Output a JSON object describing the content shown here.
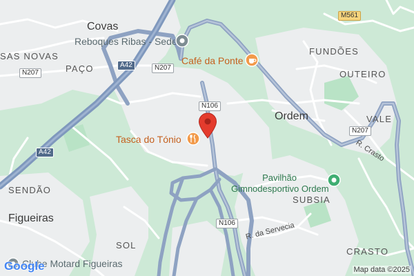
{
  "colors": {
    "land": "#cde9d6",
    "urban": "#eceeef",
    "park": "#b9e3c6",
    "road_minor": "#ffffff",
    "road_major": "#8ea2c2",
    "highway": "#7f98bd",
    "poi_orange": "#f29a4a",
    "poi_gray": "#7e8d93",
    "poi_green": "#3fae72",
    "marker": "#e43b2d"
  },
  "places": {
    "covas": "Covas",
    "casas_novas": "SAS NOVAS",
    "paco": "PAÇO",
    "fundoes": "FUNDÕES",
    "outeiro": "OUTEIRO",
    "ordem": "Ordem",
    "vale": "VALE",
    "sendao": "SENDÃO",
    "figueiras": "Figueiras",
    "subsia": "SUBSIA",
    "sol": "SOL",
    "crasto": "CRASTO"
  },
  "pois": {
    "reboques": {
      "name": "Reboques Ribas - Sede",
      "icon": "gray-pin-icon"
    },
    "cafe": {
      "name": "Café da Ponte",
      "icon": "coffee-icon"
    },
    "tasca": {
      "name": "Tasca do Tónio",
      "icon": "restaurant-icon"
    },
    "pavilhao": {
      "line1": "Pavilhão",
      "line2": "Gimnodesportivo Ordem",
      "icon": "sports-pin-icon"
    },
    "clube": {
      "name": "Clube Motard Figueiras",
      "icon": "gray-pin-icon"
    }
  },
  "road_labels": {
    "n207_west": "N207",
    "n207_center": "N207",
    "n207_east": "N207",
    "n106_north": "N106",
    "n106_south": "N106",
    "a42_north": "A42",
    "a42_south": "A42",
    "m561": "M561",
    "r_crasto": "R. Crasto",
    "r_servecia": "R. da Servecia"
  },
  "marker": {
    "name": "red-location-marker-icon"
  },
  "branding": {
    "logo": "Google",
    "attribution": "Map data ©2025"
  }
}
